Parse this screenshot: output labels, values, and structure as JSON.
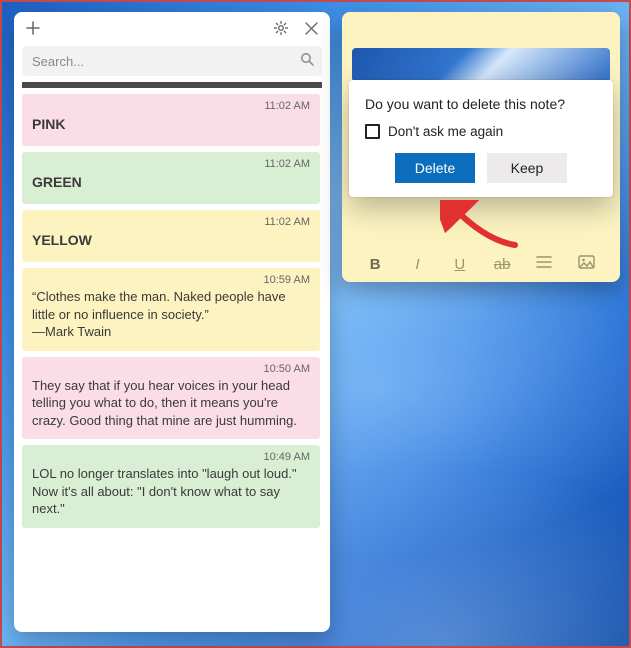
{
  "search": {
    "placeholder": "Search..."
  },
  "notes": [
    {
      "timestamp": "11:02 AM",
      "title": "PINK",
      "body": "",
      "color": "c-pink"
    },
    {
      "timestamp": "11:02 AM",
      "title": "GREEN",
      "body": "",
      "color": "c-green"
    },
    {
      "timestamp": "11:02 AM",
      "title": "YELLOW",
      "body": "",
      "color": "c-yellow"
    },
    {
      "timestamp": "10:59 AM",
      "title": "",
      "body": "“Clothes make the man. Naked people have little or no influence in society.”\n—Mark Twain",
      "color": "c-yellow"
    },
    {
      "timestamp": "10:50 AM",
      "title": "",
      "body": "They say that if you hear voices in your head telling you what to do, then it means you're crazy. Good thing that mine are just humming.",
      "color": "c-pink"
    },
    {
      "timestamp": "10:49 AM",
      "title": "",
      "body": "LOL no longer translates into \"laugh out loud.\"\nNow it's all about: \"I don't know what to say next.\"",
      "color": "c-green"
    }
  ],
  "dialog": {
    "message": "Do you want to delete this note?",
    "checkbox_label": "Don't ask me again",
    "delete_label": "Delete",
    "keep_label": "Keep"
  },
  "format_toolbar": {
    "bold": "B",
    "italic": "I",
    "underline": "U",
    "strike": "ab",
    "list": "≡",
    "image": "▣"
  },
  "colors": {
    "primary_button": "#0b6dbb",
    "pink": "#fbdde7",
    "green": "#d9efd4",
    "yellow": "#fcf3c0"
  }
}
